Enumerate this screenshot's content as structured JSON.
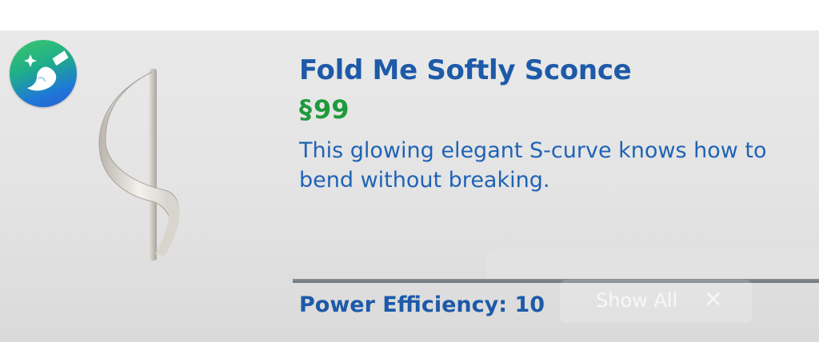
{
  "badge": {
    "icon": "sparkle-brush-icon",
    "colors": [
      "#3cc86a",
      "#1f77d8"
    ]
  },
  "item": {
    "title": "Fold Me Softly Sconce",
    "currency_symbol": "§",
    "price": "99",
    "description": "This glowing elegant S-curve knows how to bend without breaking.",
    "power_efficiency_label": "Power Efficiency: 10"
  },
  "overlay": {
    "show_all_label": "Show All",
    "close_glyph": "✕"
  },
  "colors": {
    "title": "#1d5aa8",
    "price": "#1f9a3b",
    "description": "#1f63b5"
  }
}
